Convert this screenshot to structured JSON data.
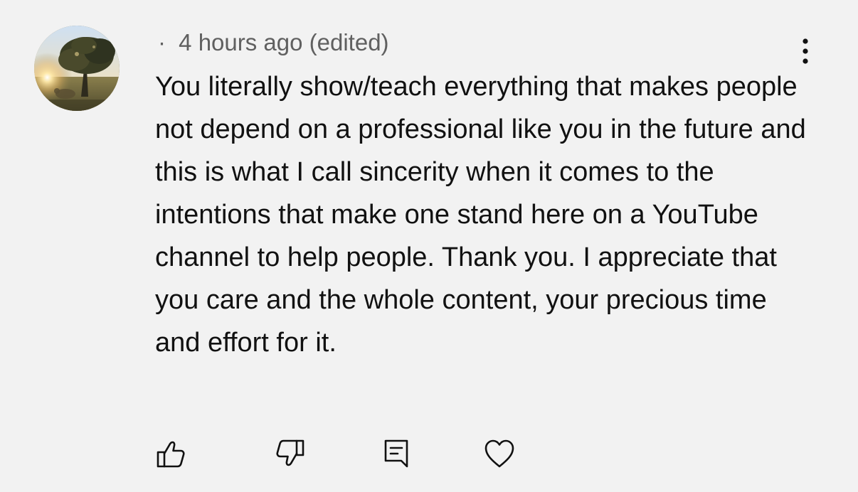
{
  "comment": {
    "timestamp": "4 hours ago",
    "edited_label": "(edited)",
    "separator": "·",
    "text": "You literally show/teach everything that makes people not depend on a professional like you in the future and this is what I call sincerity when it comes to the intentions that make one stand here on a YouTube channel to help people. Thank you. I appreciate that you care and the whole content, your precious time and effort for it."
  },
  "icons": {
    "avatar": "avatar-photo",
    "more": "more-vertical-icon",
    "like": "thumbs-up-icon",
    "dislike": "thumbs-down-icon",
    "reply": "reply-comment-icon",
    "heart": "heart-icon"
  },
  "colors": {
    "background": "#f2f2f2",
    "text": "#111111",
    "meta_text": "#606060"
  }
}
